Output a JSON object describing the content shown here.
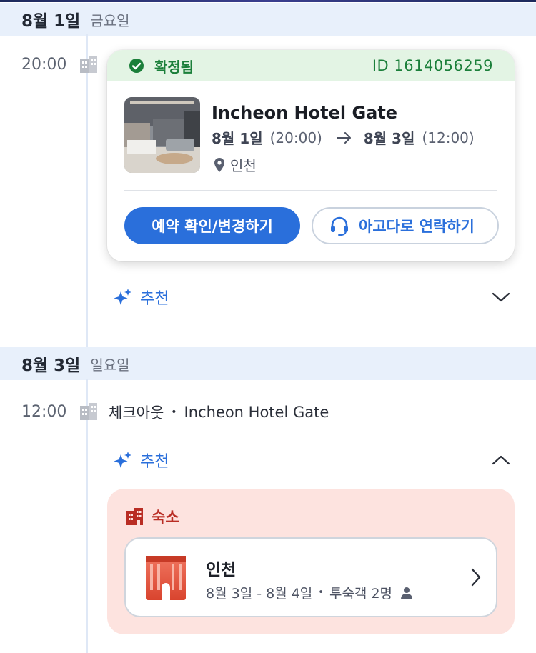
{
  "day1": {
    "date": "8월 1일",
    "weekday": "금요일"
  },
  "booking": {
    "time": "20:00",
    "status": "확정됨",
    "id": "ID 1614056259",
    "hotel_name": "Incheon Hotel Gate",
    "checkin_date": "8월 1일",
    "checkin_time": "(20:00)",
    "checkout_date": "8월 3일",
    "checkout_time": "(12:00)",
    "location": "인천",
    "primary_button": "예약 확인/변경하기",
    "secondary_button": "아고다로 연락하기"
  },
  "recommend1": {
    "label": "추천"
  },
  "day2": {
    "date": "8월 3일",
    "weekday": "일요일"
  },
  "checkout": {
    "time": "12:00",
    "label": "체크아웃",
    "separator": "•",
    "hotel": "Incheon Hotel Gate"
  },
  "recommend2": {
    "label": "추천"
  },
  "lodging": {
    "section_title": "숙소",
    "city": "인천",
    "dates": "8월 3일 - 8월 4일",
    "separator": "•",
    "guests": "투숙객 2명"
  },
  "colors": {
    "accent_blue": "#2a6fdb",
    "confirmed_green": "#1b7f3a",
    "lodging_red": "#b92d24",
    "date_header_bg": "#e8f0fb"
  },
  "icons": [
    "building-icon",
    "check-circle-icon",
    "arrow-right-icon",
    "location-pin-icon",
    "headset-icon",
    "sparkle-icon",
    "chevron-down-icon",
    "chevron-up-icon",
    "hotel-tower-icon",
    "person-icon",
    "chevron-right-icon"
  ]
}
